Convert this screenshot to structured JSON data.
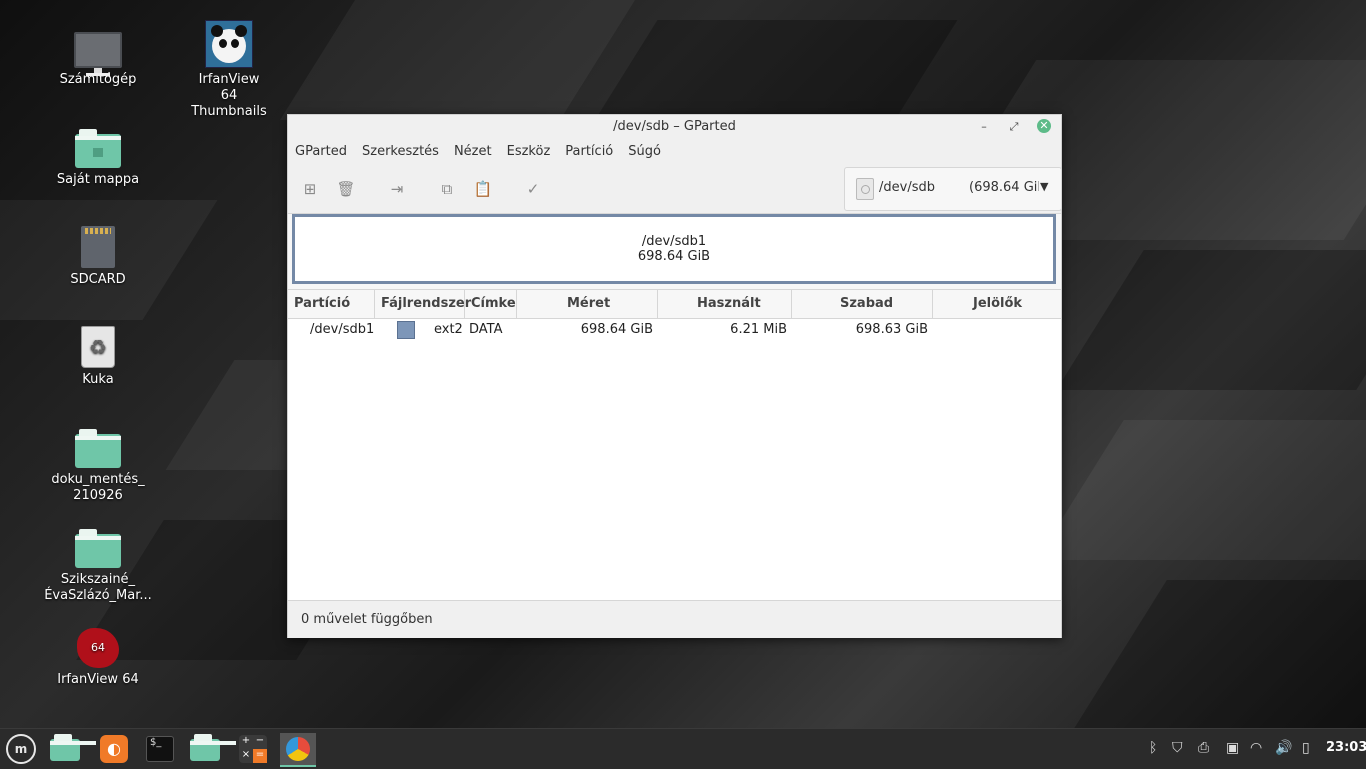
{
  "desktop": {
    "icons": [
      {
        "label": "Számítógép"
      },
      {
        "label": "IrfanView 64 Thumbnails"
      },
      {
        "label": "Saját mappa"
      },
      {
        "label": "SDCARD"
      },
      {
        "label": "Kuka"
      },
      {
        "label": "doku_mentés_ 210926"
      },
      {
        "label": "Szikszainé_ ÉvaSzlázó_Mar..."
      },
      {
        "label": "IrfanView 64"
      }
    ],
    "irfan_badge": "64"
  },
  "window": {
    "title": "/dev/sdb – GParted",
    "menu": [
      "GParted",
      "Szerkesztés",
      "Nézet",
      "Eszköz",
      "Partíció",
      "Súgó"
    ],
    "device": {
      "name": "/dev/sdb",
      "size": "(698.64 GiB"
    },
    "visual": {
      "name": "/dev/sdb1",
      "size": "698.64 GiB"
    },
    "columns": [
      "Partíció",
      "Fájlrendszer",
      "Címke",
      "Méret",
      "Használt",
      "Szabad",
      "Jelölők"
    ],
    "rows": [
      {
        "partition": "/dev/sdb1",
        "fs": "ext2",
        "label": "DATA",
        "size": "698.64 GiB",
        "used": "6.21 MiB",
        "free": "698.63 GiB",
        "flags": ""
      }
    ],
    "status": "0 művelet függőben"
  },
  "taskbar": {
    "clock": "23:03"
  },
  "colors": {
    "accent": "#6fc6a8",
    "partition_ext2": "#7d96b8"
  }
}
